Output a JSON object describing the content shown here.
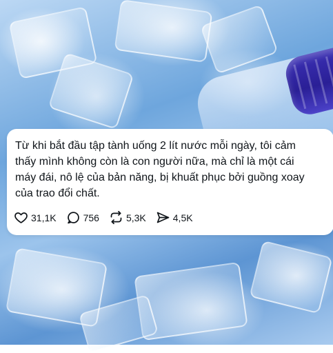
{
  "post": {
    "text": "Từ khi bắt đầu tập tành uống 2 lít nước mỗi ngày, tôi cảm\nthấy mình không còn là con người nữa, mà chỉ là một cái\nmáy đái, nô lệ của bản năng, bị khuất phục bởi guồng xoay\ncủa trao đổi chất.",
    "likes": "31,1K",
    "replies": "756",
    "reposts": "5,3K",
    "shares": "4,5K"
  },
  "icons": {
    "like": "heart-icon",
    "reply": "comment-bubble-icon",
    "repost": "repost-arrows-icon",
    "share": "send-paper-plane-icon"
  },
  "colors": {
    "text": "#0f1419",
    "card_background": "#ffffff",
    "bottle_cap": "#2a1f96"
  }
}
